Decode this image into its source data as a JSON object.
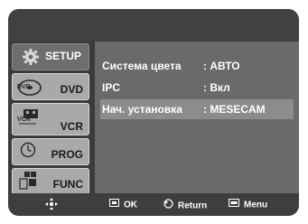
{
  "sidebar": {
    "items": [
      {
        "label": "SETUP",
        "icon": "gear-icon",
        "active": true
      },
      {
        "label": "DVD",
        "icon": "dvd-disc-icon",
        "icon_text": "DVD",
        "active": false
      },
      {
        "label": "VCR",
        "icon": "vcr-tape-icon",
        "icon_text": "VCR",
        "active": false
      },
      {
        "label": "PROG",
        "icon": "clock-icon",
        "active": false
      },
      {
        "label": "FUNC",
        "icon": "function-grid-icon",
        "active": false
      }
    ]
  },
  "menu": {
    "rows": [
      {
        "label": "Система цвета",
        "value": ": АВТО",
        "selected": false
      },
      {
        "label": "IPC",
        "value": ": Вкл",
        "selected": false
      },
      {
        "label": "Нач. установка",
        "value": ": MESECAM",
        "selected": true
      }
    ]
  },
  "footer": {
    "ok_label": "OK",
    "return_label": "Return",
    "menu_label": "Menu",
    "nav_icon": "navigation-cross-icon",
    "ok_icon": "enter-icon",
    "return_icon": "return-arrow-icon",
    "menu_icon": "menu-icon"
  },
  "colors": {
    "frame": "#3b3b3b",
    "content_bg": "#6a6a6a",
    "selected_row": "#8c8c8c",
    "sidebar_active": "#6d6d6d",
    "sidebar_inactive": "#a9a9a9",
    "text": "#ffffff"
  }
}
